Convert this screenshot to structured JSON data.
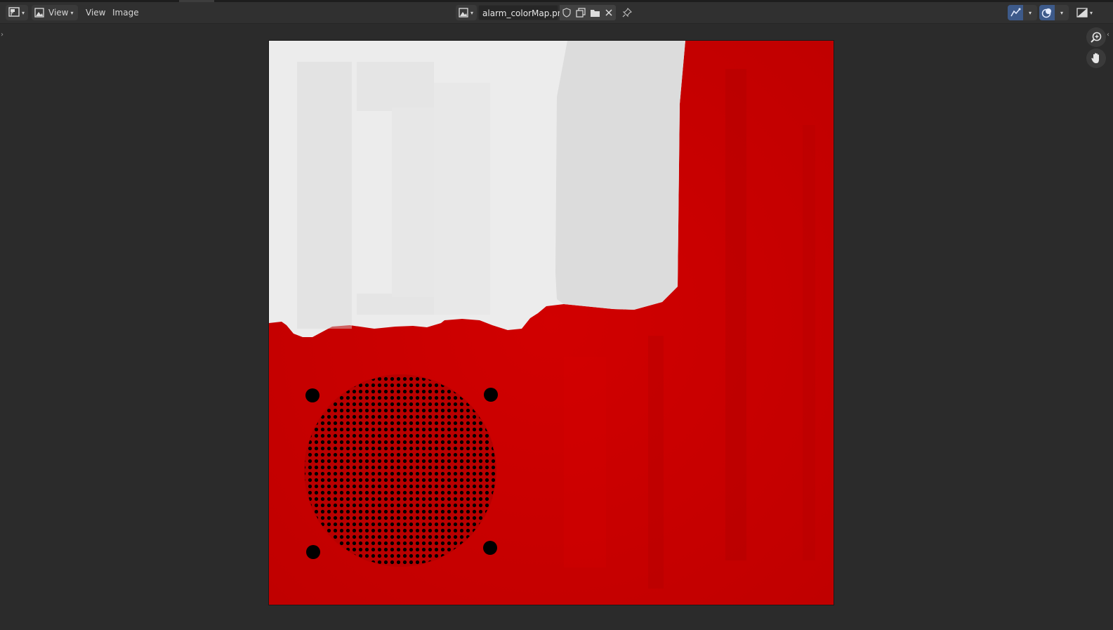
{
  "editor": {
    "menus": [
      "View",
      "Image"
    ],
    "view_dropdown_label": "View",
    "image_name": "alarm_colorMap.png"
  },
  "colors": {
    "texture_red": "#c80000",
    "texture_white": "#ececec",
    "texture_gray": "#dedede",
    "speaker_black": "#000000",
    "header_bg": "#303030",
    "viewport_bg": "#2b2b2b",
    "active_toggle": "#3d5a8a"
  },
  "icons": {
    "editor_type": "image-editor-icon",
    "mode": "image-icon",
    "browse_image": "image-browse-icon",
    "fake_user": "shield-icon",
    "duplicate": "duplicate-icon",
    "open": "folder-icon",
    "unlink": "close-icon",
    "pin": "pin-icon",
    "gizmo": "gizmo-icon",
    "overlay": "overlay-icon",
    "display_channels": "display-channels-icon",
    "zoom": "zoom-icon",
    "pan": "hand-icon"
  }
}
